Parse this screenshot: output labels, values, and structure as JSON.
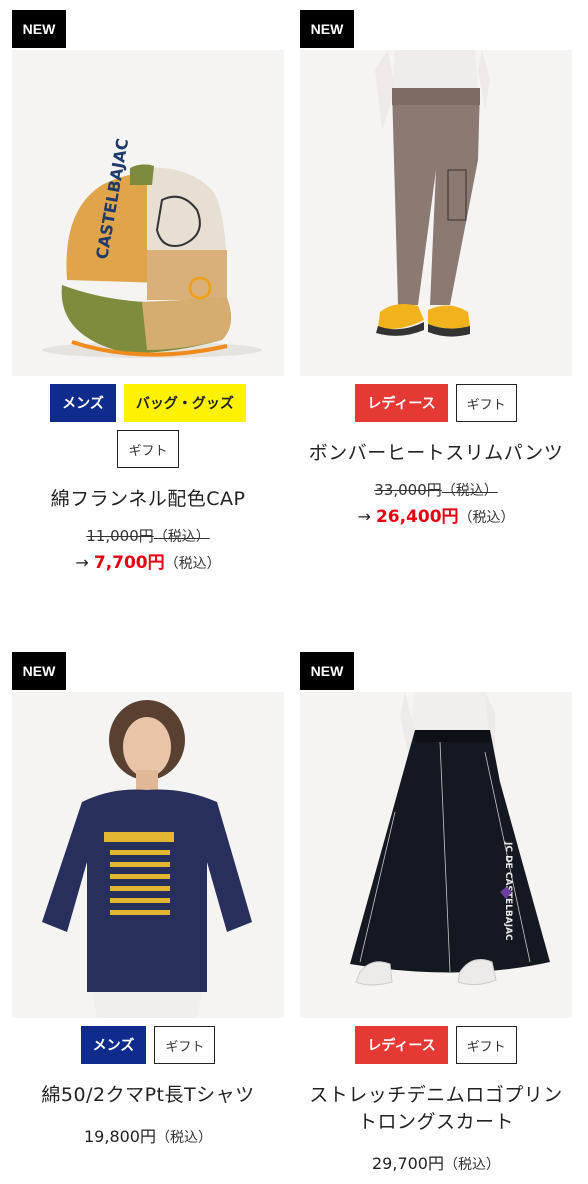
{
  "products": [
    {
      "new_label": "NEW",
      "image_alt": "cap-photo",
      "tags": [
        {
          "label": "メンズ",
          "kind": "men"
        },
        {
          "label": "バッグ・グッズ",
          "kind": "goods"
        },
        {
          "label": "ギフト",
          "kind": "gift"
        }
      ],
      "title": "綿フランネル配色CAP",
      "price_old": "11,000円",
      "price_old_tax": "（税込）",
      "arrow": "→",
      "price_sale": "7,700円",
      "price_sale_tax": "（税込）"
    },
    {
      "new_label": "NEW",
      "image_alt": "pants-photo",
      "tags": [
        {
          "label": "レディース",
          "kind": "ladies"
        },
        {
          "label": "ギフト",
          "kind": "gift"
        }
      ],
      "title": "ボンバーヒートスリムパンツ",
      "price_old": "33,000円",
      "price_old_tax": "（税込）",
      "arrow": "→",
      "price_sale": "26,400円",
      "price_sale_tax": "（税込）"
    },
    {
      "new_label": "NEW",
      "image_alt": "tshirt-photo",
      "tags": [
        {
          "label": "メンズ",
          "kind": "men"
        },
        {
          "label": "ギフト",
          "kind": "gift"
        }
      ],
      "title": "綿50/2クマPt長Tシャツ",
      "price": "19,800円",
      "price_tax": "（税込）"
    },
    {
      "new_label": "NEW",
      "image_alt": "skirt-photo",
      "tags": [
        {
          "label": "レディース",
          "kind": "ladies"
        },
        {
          "label": "ギフト",
          "kind": "gift"
        }
      ],
      "title": "ストレッチデニムロゴプリントロングスカート",
      "price": "29,700円",
      "price_tax": "（税込）"
    }
  ],
  "colors": {
    "men": "#0f2c8c",
    "goods": "#fff200",
    "ladies": "#e53935",
    "sale": "#e60012"
  }
}
